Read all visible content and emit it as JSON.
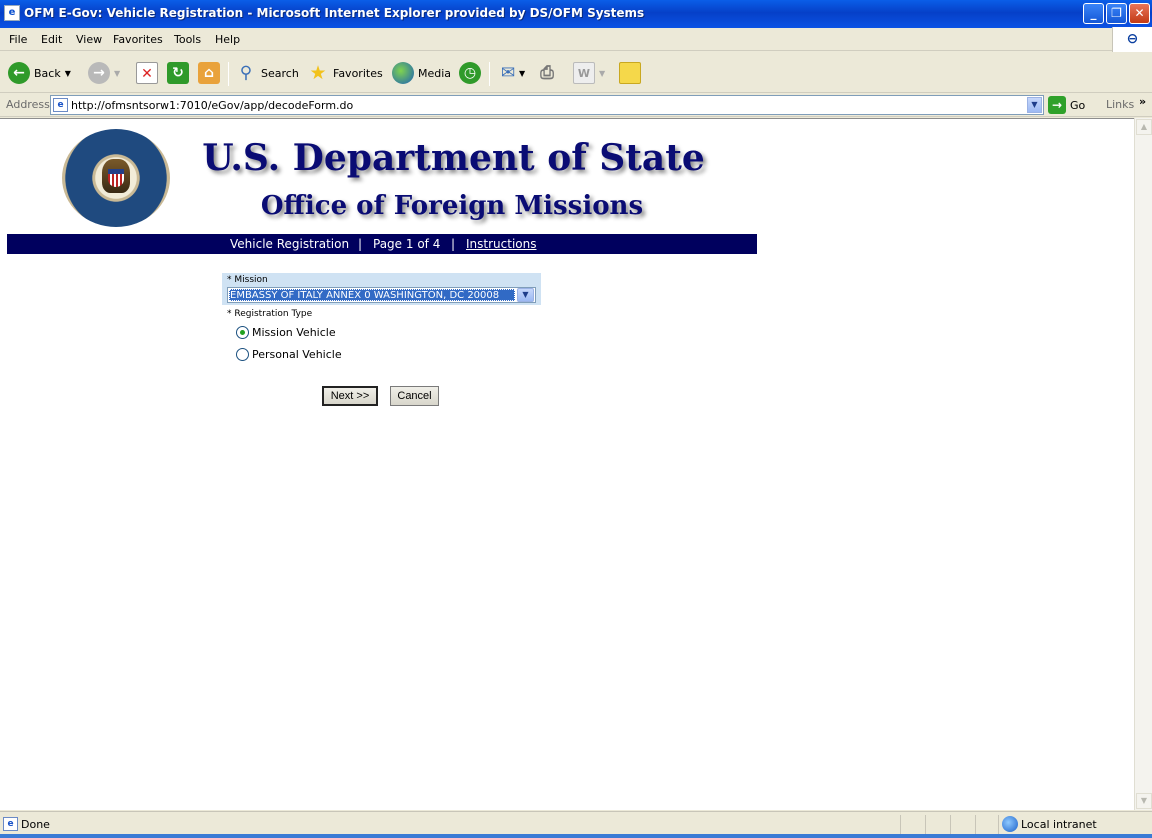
{
  "window": {
    "title": "OFM E-Gov: Vehicle Registration - Microsoft Internet Explorer provided by DS/OFM Systems",
    "controls": {
      "minimize": "_",
      "maximize": "❐",
      "close": "✕"
    }
  },
  "menu": [
    "File",
    "Edit",
    "View",
    "Favorites",
    "Tools",
    "Help"
  ],
  "toolbar": {
    "back_label": "Back",
    "search_label": "Search",
    "favorites_label": "Favorites",
    "media_label": "Media"
  },
  "address": {
    "label": "Address",
    "url": "http://ofmsntsorw1:7010/eGov/app/decodeForm.do",
    "go_label": "Go",
    "links_label": "Links",
    "more": "»"
  },
  "page": {
    "heading": "U.S. Department of State",
    "subheading": "Office of Foreign Missions",
    "nav": {
      "section": "Vehicle Registration",
      "sep1": "|",
      "page": "Page 1 of 4",
      "sep2": "|",
      "instructions": "Instructions"
    },
    "mission": {
      "label": "* Mission",
      "selected": "EMBASSY OF ITALY ANNEX 0 WASHINGTON, DC 20008"
    },
    "registration_type": {
      "label": "* Registration Type",
      "options": [
        {
          "label": "Mission Vehicle",
          "checked": true
        },
        {
          "label": "Personal Vehicle",
          "checked": false
        }
      ]
    },
    "buttons": {
      "next": "Next >>",
      "cancel": "Cancel"
    }
  },
  "status": {
    "text": "Done",
    "zone": "Local intranet"
  },
  "colors": {
    "header_text": "#0a0c74",
    "nav_bar": "#00005e",
    "mission_panel": "#cfe2f3",
    "selection": "#316ac5"
  }
}
